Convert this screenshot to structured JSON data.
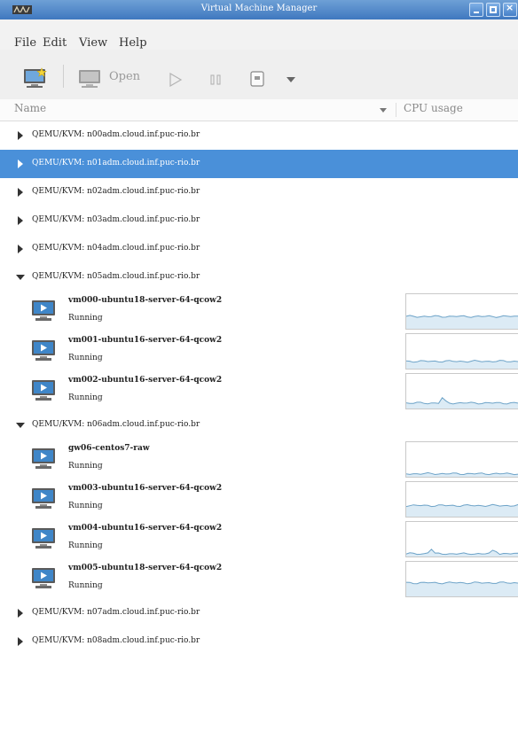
{
  "window": {
    "title": "Virtual Machine Manager",
    "app_icon": "virt-manager-icon",
    "buttons": [
      "minimize-icon",
      "maximize-icon",
      "close-icon"
    ]
  },
  "menu": [
    "File",
    "Edit",
    "View",
    "Help"
  ],
  "toolbar": {
    "new_vm_icon": "new-vm-icon",
    "console_icon": "monitor-icon",
    "open_label": "Open",
    "run_icon": "play-icon",
    "pause_icon": "pause-icon",
    "shutdown_icon": "shutdown-icon",
    "menu_icon": "dropdown-arrow-icon"
  },
  "columns": {
    "name": "Name",
    "cpu": "CPU usage"
  },
  "colors": {
    "selection": "#4a90d9",
    "graph_fill": "#dcebf5",
    "graph_line": "#6da3c8"
  },
  "rows": [
    {
      "type": "connection",
      "label": "QEMU/KVM: n00adm.cloud.inf.puc-rio.br",
      "expanded": false,
      "selected": false
    },
    {
      "type": "connection",
      "label": "QEMU/KVM: n01adm.cloud.inf.puc-rio.br",
      "expanded": false,
      "selected": true
    },
    {
      "type": "connection",
      "label": "QEMU/KVM: n02adm.cloud.inf.puc-rio.br",
      "expanded": false,
      "selected": false
    },
    {
      "type": "connection",
      "label": "QEMU/KVM: n03adm.cloud.inf.puc-rio.br",
      "expanded": false,
      "selected": false
    },
    {
      "type": "connection",
      "label": "QEMU/KVM: n04adm.cloud.inf.puc-rio.br",
      "expanded": false,
      "selected": false
    },
    {
      "type": "connection",
      "label": "QEMU/KVM: n05adm.cloud.inf.puc-rio.br",
      "expanded": true,
      "selected": false
    },
    {
      "type": "vm",
      "name": "vm000-ubuntu18-server-64-qcow2",
      "status": "Running",
      "cpu_level": 0.34,
      "cpu_spikes": []
    },
    {
      "type": "vm",
      "name": "vm001-ubuntu16-server-64-qcow2",
      "status": "Running",
      "cpu_level": 0.18,
      "cpu_spikes": []
    },
    {
      "type": "vm",
      "name": "vm002-ubuntu16-server-64-qcow2",
      "status": "Running",
      "cpu_level": 0.12,
      "cpu_spikes": [
        0.3
      ]
    },
    {
      "type": "connection",
      "label": "QEMU/KVM: n06adm.cloud.inf.puc-rio.br",
      "expanded": true,
      "selected": false
    },
    {
      "type": "vm",
      "name": "gw06-centos7-raw",
      "status": "Running",
      "cpu_level": 0.04,
      "cpu_spikes": []
    },
    {
      "type": "vm",
      "name": "vm003-ubuntu16-server-64-qcow2",
      "status": "Running",
      "cpu_level": 0.3,
      "cpu_spikes": []
    },
    {
      "type": "vm",
      "name": "vm004-ubuntu16-server-64-qcow2",
      "status": "Running",
      "cpu_level": 0.03,
      "cpu_spikes": [
        0.2,
        0.72
      ]
    },
    {
      "type": "vm",
      "name": "vm005-ubuntu18-server-64-qcow2",
      "status": "Running",
      "cpu_level": 0.38,
      "cpu_spikes": []
    },
    {
      "type": "connection",
      "label": "QEMU/KVM: n07adm.cloud.inf.puc-rio.br",
      "expanded": false,
      "selected": false
    },
    {
      "type": "connection",
      "label": "QEMU/KVM: n08adm.cloud.inf.puc-rio.br",
      "expanded": false,
      "selected": false
    }
  ]
}
